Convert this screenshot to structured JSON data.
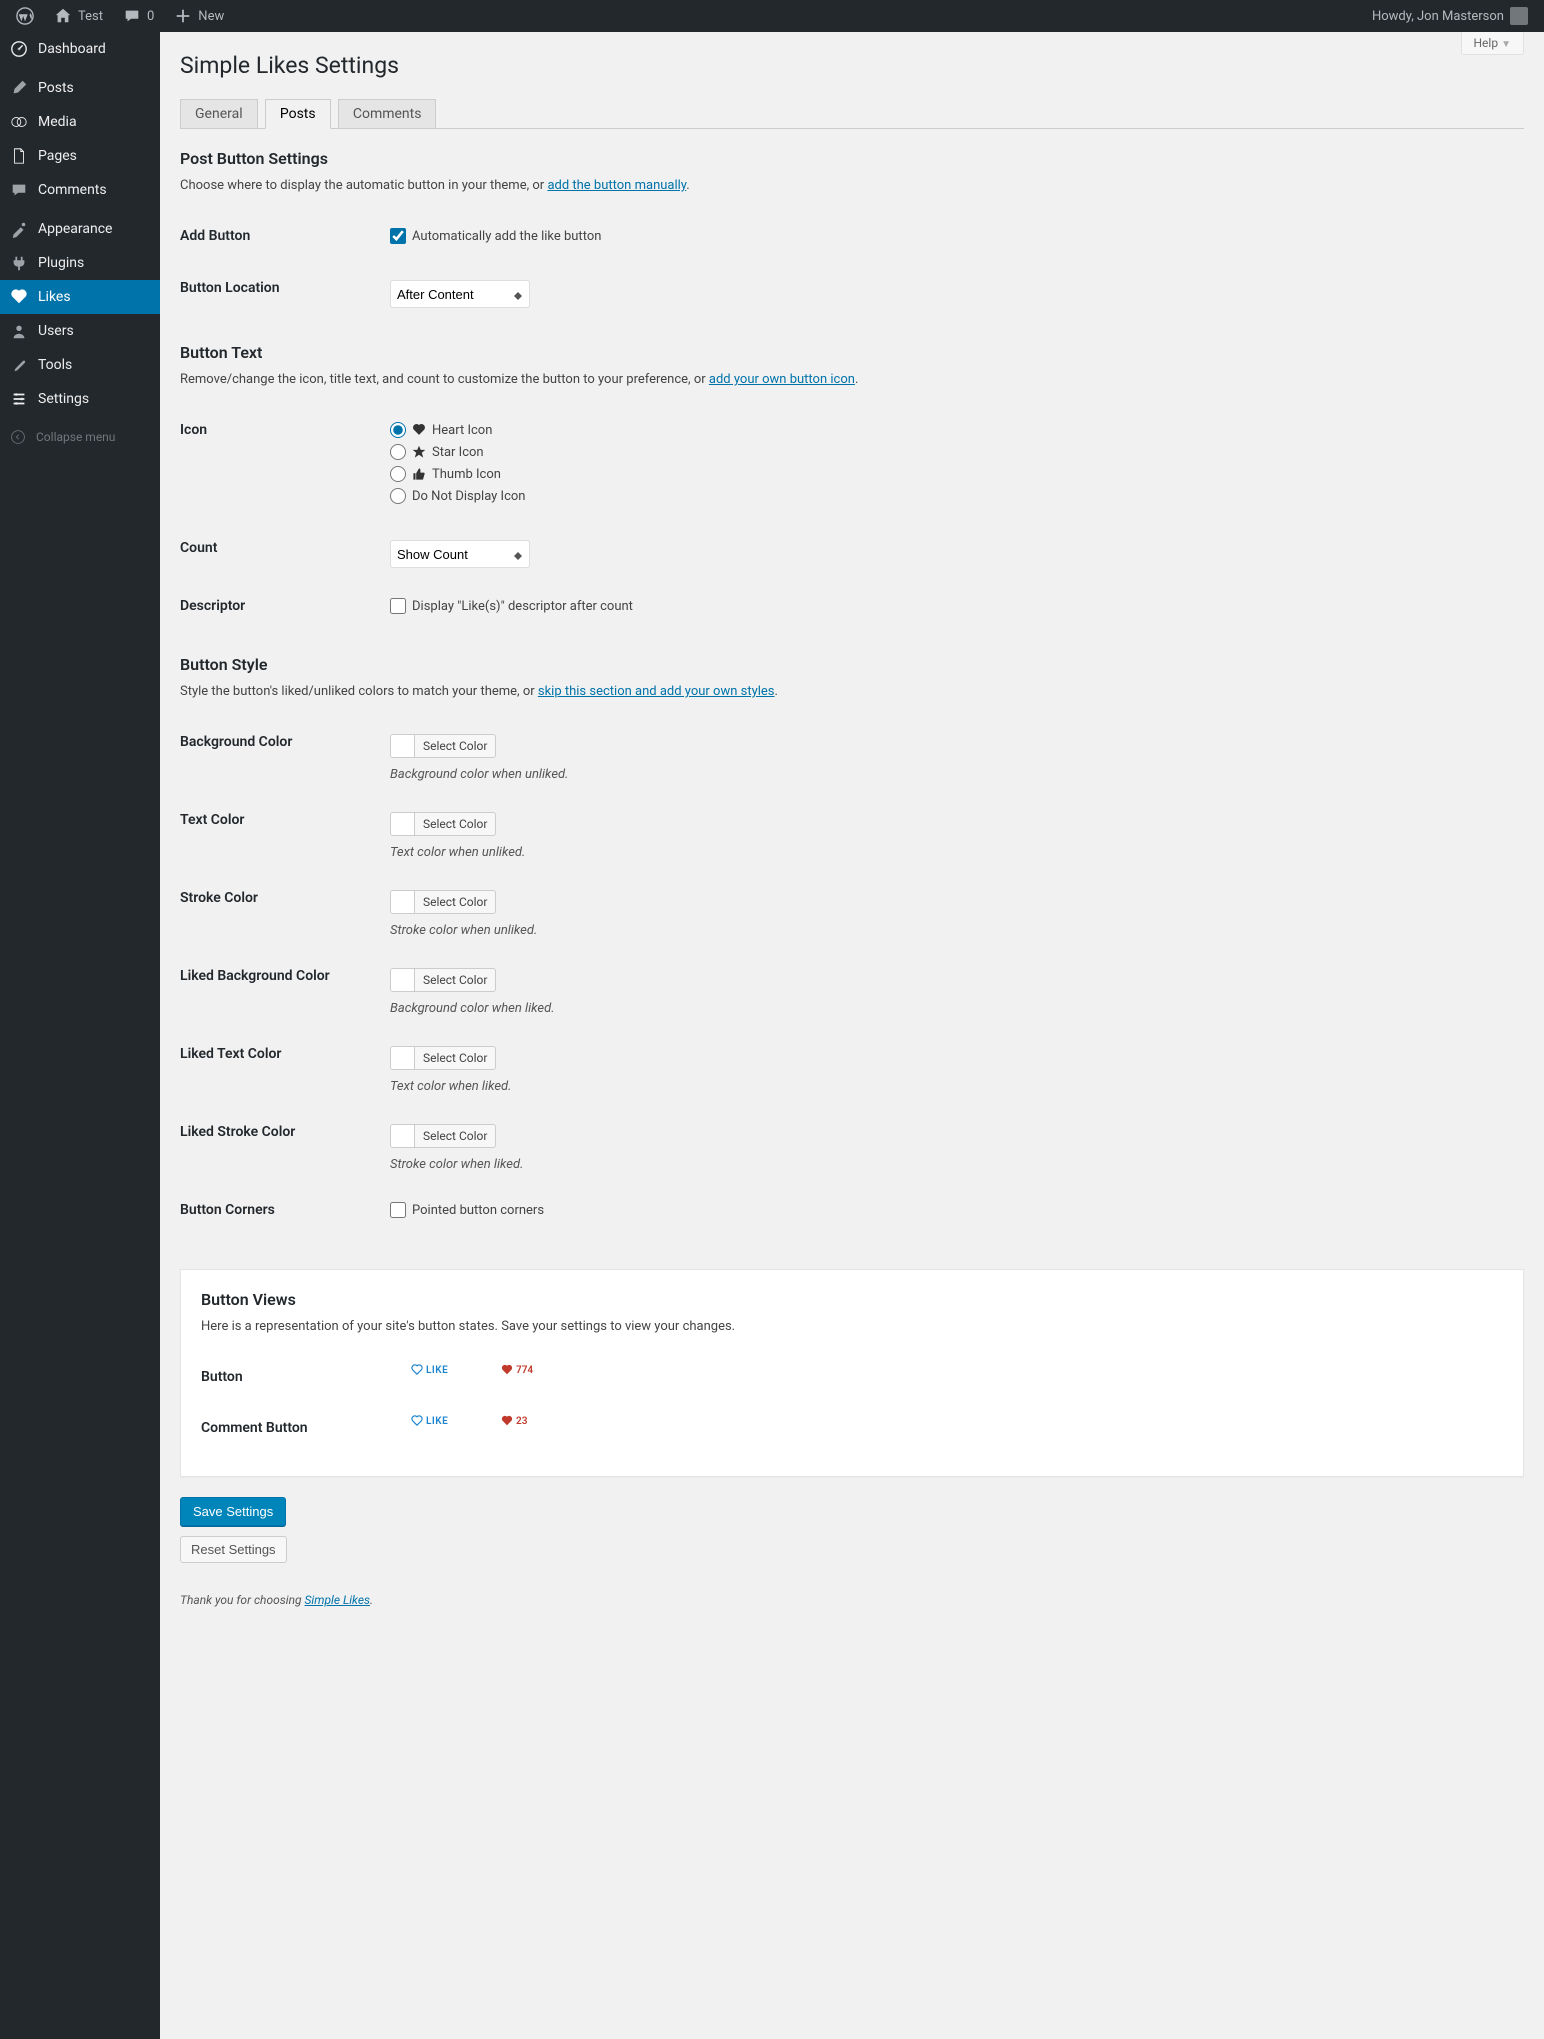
{
  "adminbar": {
    "site_name": "Test",
    "comment_count": "0",
    "new_label": "New",
    "howdy": "Howdy, Jon Masterson"
  },
  "sidebar": {
    "dashboard": "Dashboard",
    "posts": "Posts",
    "media": "Media",
    "pages": "Pages",
    "comments": "Comments",
    "appearance": "Appearance",
    "plugins": "Plugins",
    "likes": "Likes",
    "users": "Users",
    "tools": "Tools",
    "settings": "Settings",
    "collapse": "Collapse menu"
  },
  "help_label": "Help",
  "page_title": "Simple Likes Settings",
  "tabs": {
    "general": "General",
    "posts": "Posts",
    "comments": "Comments"
  },
  "sections": {
    "post_button": {
      "heading": "Post Button Settings",
      "intro_pre": "Choose where to display the automatic button in your theme, or ",
      "intro_link": "add the button manually",
      "intro_post": "."
    },
    "button_text": {
      "heading": "Button Text",
      "intro_pre": "Remove/change the icon, title text, and count to customize the button to your preference, or ",
      "intro_link": "add your own button icon",
      "intro_post": "."
    },
    "button_style": {
      "heading": "Button Style",
      "intro_pre": "Style the button's liked/unliked colors to match your theme, or ",
      "intro_link": "skip this section and add your own styles",
      "intro_post": "."
    },
    "button_views": {
      "heading": "Button Views",
      "intro": "Here is a representation of your site's button states. Save your settings to view your changes."
    }
  },
  "fields": {
    "add_button": {
      "label": "Add Button",
      "option": "Automatically add the like button"
    },
    "button_location": {
      "label": "Button Location",
      "value": "After Content"
    },
    "icon": {
      "label": "Icon",
      "options": {
        "heart": "Heart Icon",
        "star": "Star Icon",
        "thumb": "Thumb Icon",
        "none": "Do Not Display Icon"
      }
    },
    "count": {
      "label": "Count",
      "value": "Show Count"
    },
    "descriptor": {
      "label": "Descriptor",
      "option": "Display \"Like(s)\" descriptor after count"
    },
    "bg_color": {
      "label": "Background Color",
      "desc": "Background color when unliked."
    },
    "text_color": {
      "label": "Text Color",
      "desc": "Text color when unliked."
    },
    "stroke_color": {
      "label": "Stroke Color",
      "desc": "Stroke color when unliked."
    },
    "liked_bg": {
      "label": "Liked Background Color",
      "desc": "Background color when liked."
    },
    "liked_text": {
      "label": "Liked Text Color",
      "desc": "Text color when liked."
    },
    "liked_stroke": {
      "label": "Liked Stroke Color",
      "desc": "Stroke color when liked."
    },
    "corners": {
      "label": "Button Corners",
      "option": "Pointed button corners"
    },
    "select_color": "Select Color"
  },
  "preview": {
    "button_row": "Button",
    "comment_row": "Comment Button",
    "like_label": "LIKE",
    "count1": "774",
    "count2": "23"
  },
  "save_btn": "Save Settings",
  "reset_btn": "Reset Settings",
  "footer_pre": "Thank you for choosing ",
  "footer_link": "Simple Likes",
  "footer_post": "."
}
